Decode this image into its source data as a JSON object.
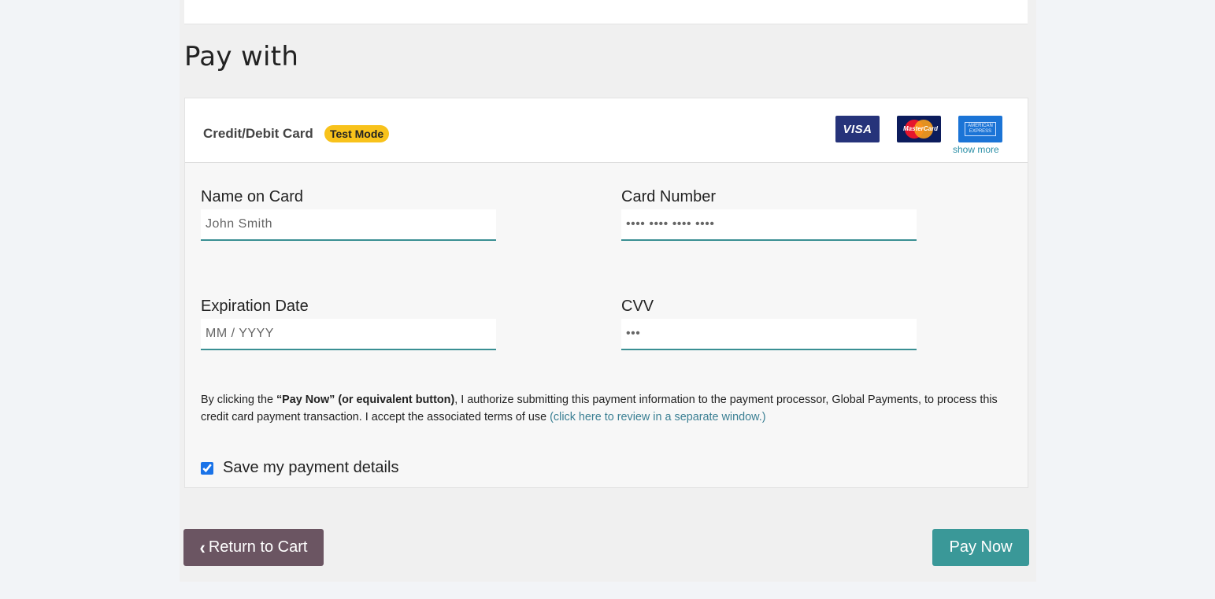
{
  "section": {
    "title": "Pay with"
  },
  "payment_method": {
    "label": "Credit/Debit Card",
    "badge": "Test Mode",
    "brands": {
      "visa": "VISA",
      "mastercard": "MasterCard",
      "amex_line1": "AMERICAN",
      "amex_line2": "EXPRESS"
    },
    "show_more": "show more"
  },
  "form": {
    "name_label": "Name on Card",
    "name_placeholder": "John Smith",
    "card_number_label": "Card Number",
    "card_number_placeholder": "•••• •••• •••• ••••",
    "expiration_label": "Expiration Date",
    "expiration_placeholder": "MM / YYYY",
    "cvv_label": "CVV",
    "cvv_placeholder": "•••"
  },
  "consent": {
    "prefix": "By clicking the ",
    "button_ref": "“Pay Now” (or equivalent button)",
    "body": ", I authorize submitting this payment information to the payment processor, Global Payments, to process this credit card payment transaction. I accept the associated terms of use ",
    "link": "(click here to review in a separate window.)"
  },
  "save_details": {
    "label": "Save my payment details",
    "checked": true
  },
  "actions": {
    "return_chevron": "‹",
    "return_label": "Return to Cart",
    "pay_label": "Pay Now"
  },
  "colors": {
    "badge": "#f8c21b",
    "input_underline": "#3a8f93",
    "return_button": "#6b5562",
    "pay_button": "#3a9898",
    "link": "#2b8fa6"
  }
}
